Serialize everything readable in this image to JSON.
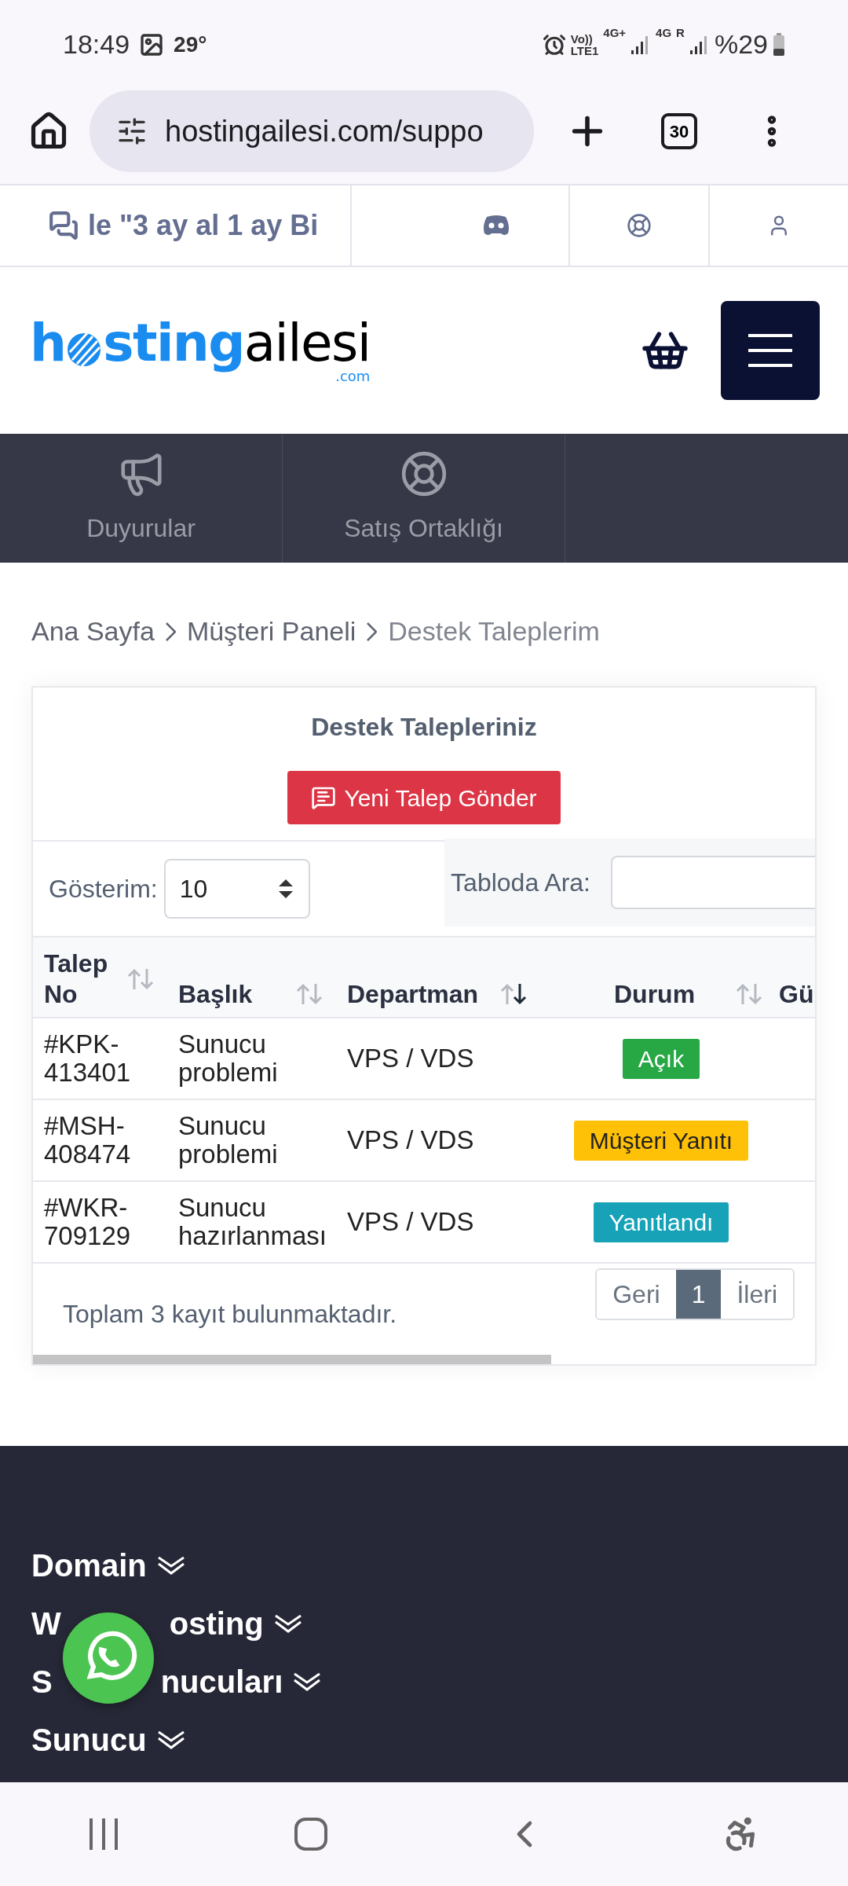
{
  "status_bar": {
    "time": "18:49",
    "temperature": "29°",
    "network": [
      "Vo))",
      "LTE1",
      "4G+",
      "4G",
      "R"
    ],
    "battery": "%29"
  },
  "browser": {
    "url": "hostingailesi.com/suppo",
    "tab_count": "30"
  },
  "top_bar": {
    "marquee": "le \"3 ay al 1 ay Bi"
  },
  "logo": {
    "start": "h",
    "middle": "sting",
    "end": "ailesi",
    "suffix": ".com"
  },
  "nav": [
    {
      "kind": "megaphone",
      "label": "Duyurular"
    },
    {
      "kind": "lifebuoy",
      "label": "Satış Ortaklığı"
    }
  ],
  "breadcrumb": [
    "Ana Sayfa",
    "Müşteri Paneli",
    "Destek Taleplerim"
  ],
  "card": {
    "title": "Destek Talepleriniz",
    "new_button": "Yeni Talep Gönder",
    "show_label": "Gösterim:",
    "show_value": "10",
    "search_label": "Tabloda Ara:",
    "table": {
      "columns": [
        {
          "label": "Talep No",
          "sorted": false
        },
        {
          "label": "Başlık",
          "sorted": false
        },
        {
          "label": "Departman",
          "sorted": true
        },
        {
          "label": "Durum",
          "sorted": false
        },
        {
          "label": "Gü"
        }
      ],
      "rows": [
        {
          "no": "#KPK-413401",
          "title": "Sunucu problemi",
          "department": "VPS / VDS",
          "status": "Açık",
          "color": "#28a745"
        },
        {
          "no": "#MSH-408474",
          "title": "Sunucu problemi",
          "department": "VPS / VDS",
          "status": "Müşteri Yanıtı",
          "color": "#ffc107"
        },
        {
          "no": "#WKR-709129",
          "title": "Sunucu hazırlanması",
          "department": "VPS / VDS",
          "status": "Yanıtlandı",
          "color": "#17a2b8"
        }
      ]
    },
    "total": "Toplam 3 kayıt bulunmaktadır.",
    "pagination": [
      {
        "label": "Geri",
        "selected": false
      },
      {
        "label": "1",
        "selected": true
      },
      {
        "label": "İleri",
        "selected": false
      }
    ]
  },
  "footer": {
    "items": [
      {
        "start": "Domain"
      },
      {
        "start": "W",
        "end": "osting"
      },
      {
        "start": "S",
        "end": "nucuları"
      },
      {
        "start": "Sunucu"
      }
    ]
  }
}
